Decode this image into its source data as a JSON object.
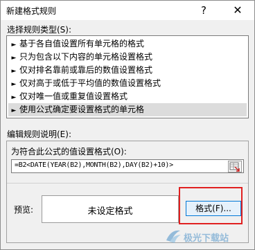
{
  "window": {
    "title": "新建格式规则",
    "help_label": "?",
    "close_label": "✕"
  },
  "rule_type": {
    "label": "选择规则类型(S):",
    "items": [
      {
        "label": "基于各自值设置所有单元格的格式"
      },
      {
        "label": "只为包含以下内容的单元格设置格式"
      },
      {
        "label": "仅对排名靠前或靠后的数值设置格式"
      },
      {
        "label": "仅对高于或低于平均值的数值设置格式"
      },
      {
        "label": "仅对唯一值或重复值设置格式"
      },
      {
        "label": "使用公式确定要设置格式的单元格",
        "selected": true
      }
    ],
    "arrow_glyph": "►"
  },
  "edit": {
    "label": "编辑规则说明(E):",
    "formula_label": "为符合此公式的值设置格式(O):",
    "formula_value": "=B2<DATE(YEAR(B2),MONTH(B2),DAY(B2)+10)>",
    "preview_label": "预览:",
    "preview_text": "未设定格式",
    "format_button": "格式(F)..."
  },
  "watermark": {
    "text": "极光下载站"
  },
  "colors": {
    "highlight": "#e02020",
    "selected_row": "#dcdcdc",
    "button_border": "#0078d7"
  }
}
